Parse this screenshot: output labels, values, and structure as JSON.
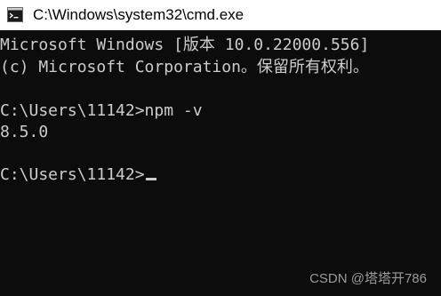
{
  "window": {
    "title": "C:\\Windows\\system32\\cmd.exe",
    "icon": "cmd-icon"
  },
  "console": {
    "lines": [
      "Microsoft Windows [版本 10.0.22000.556]",
      "(c) Microsoft Corporation。保留所有权利。",
      "C:\\Users\\11142>npm -v",
      "8.5.0",
      "C:\\Users\\11142>"
    ]
  },
  "watermark": "CSDN @塔塔开786",
  "colors": {
    "console_bg": "#0c0c0c",
    "console_fg": "#cccccc",
    "titlebar_bg": "#ffffff"
  }
}
